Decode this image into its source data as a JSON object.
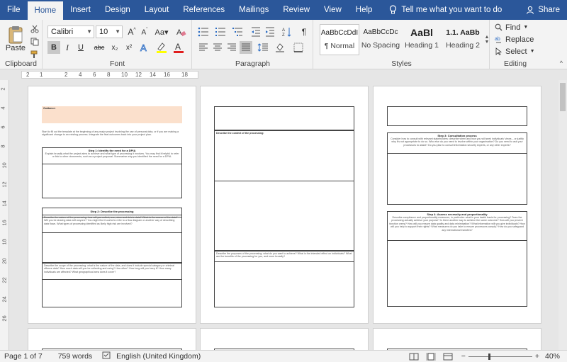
{
  "tabs": {
    "file": "File",
    "home": "Home",
    "insert": "Insert",
    "design": "Design",
    "layout": "Layout",
    "references": "References",
    "mailings": "Mailings",
    "review": "Review",
    "view": "View",
    "help": "Help"
  },
  "tell_me": "Tell me what you want to do",
  "share": "Share",
  "clipboard": {
    "paste": "Paste",
    "label": "Clipboard"
  },
  "font": {
    "name": "Calibri",
    "size": "10",
    "label": "Font",
    "bold": "B",
    "italic": "I",
    "underline": "U",
    "strike": "abc",
    "sub": "x₂",
    "sup": "x²"
  },
  "paragraph": {
    "label": "Paragraph"
  },
  "styles": {
    "label": "Styles",
    "items": [
      {
        "preview": "AaBbCcDdI",
        "name": "¶ Normal"
      },
      {
        "preview": "AaBbCcDc",
        "name": "No Spacing"
      },
      {
        "preview": "AaBl",
        "name": "Heading 1"
      },
      {
        "preview": "1.1. AaBb",
        "name": "Heading 2"
      }
    ]
  },
  "editing": {
    "label": "Editing",
    "find": "Find",
    "replace": "Replace",
    "select": "Select"
  },
  "ruler": {
    "marks": [
      "2",
      "1",
      "2",
      "4",
      "6",
      "8",
      "10",
      "12",
      "14",
      "16",
      "18"
    ]
  },
  "vruler": {
    "marks": [
      "2",
      "4",
      "6",
      "8",
      "10",
      "12",
      "14",
      "16",
      "18",
      "20",
      "22",
      "24",
      "26"
    ]
  },
  "doc": {
    "p1_notice_title": "Guidance:",
    "p1_intro": "Start to fill out the template at the beginning of any major project involving the use of personal data, or if you are making a significant change to an existing process. Integrate the final outcomes back into your project plan.",
    "p1_step1": "Step 1: Identify the need for a DPIA",
    "p1_step1_text": "Explain broadly what the project aims to achieve and what type of processing it involves. You may find it helpful to refer or link to other documents, such as a project proposal. Summarise why you identified the need for a DPIA.",
    "p1_step2": "Step 2: Describe the processing",
    "p1_nature": "Describe the nature of the processing: how will you collect, use, store and delete data? What is the source of the data? Will you be sharing data with anyone? You might find it useful to refer to a flow diagram or another way of describing data flows. What types of processing identified as likely high risk are involved?",
    "p1_scope": "Describe the scope of the processing: what is the nature of the data, and does it include special category or criminal offence data? How much data will you be collecting and using? How often? How long will you keep it? How many individuals are affected? What geographical area does it cover?",
    "p2_context": "Describe the context of the processing:",
    "p2_purpose": "Describe the purposes of the processing: what do you want to achieve? What is the intended effect on individuals? What are the benefits of the processing for you, and more broadly?",
    "p3_step3": "Step 3: Consultation process",
    "p3_step3_text": "Consider how to consult with relevant stakeholders: describe when and how you will seek individuals' views – or justify why it's not appropriate to do so. Who else do you need to involve within your organisation? Do you need to ask your processors to assist? Do you plan to consult information security experts, or any other experts?",
    "p3_step4": "Step 4: Assess necessity and proportionality",
    "p3_step4_text": "Describe compliance and proportionality measures, in particular: what is your lawful basis for processing? Does the processing actually achieve your purpose? Is there another way to achieve the same outcome? How will you prevent function creep? How will you ensure data quality and data minimisation? What information will you give individuals? How will you help to support their rights? What measures do you take to ensure processors comply? How do you safeguard any international transfers?"
  },
  "status": {
    "page": "Page 1 of 7",
    "words": "759 words",
    "language": "English (United Kingdom)",
    "zoom": "40%"
  }
}
